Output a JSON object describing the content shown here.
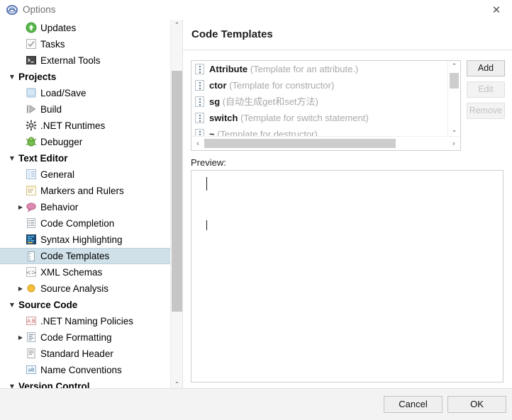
{
  "window": {
    "title": "Options",
    "icon": "app-logo-icon",
    "close_label": "✕"
  },
  "sidebar": {
    "scroll_up": "⌃",
    "scroll_down": "⌄",
    "items": [
      {
        "label": "Updates",
        "level": 1,
        "icon": "updates-icon",
        "expander": "",
        "group": false,
        "selected": false
      },
      {
        "label": "Tasks",
        "level": 1,
        "icon": "tasks-icon",
        "expander": "",
        "group": false,
        "selected": false
      },
      {
        "label": "External Tools",
        "level": 1,
        "icon": "external-tools-icon",
        "expander": "",
        "group": false,
        "selected": false
      },
      {
        "label": "Projects",
        "level": 0,
        "icon": "",
        "expander": "▼",
        "group": true,
        "selected": false
      },
      {
        "label": "Load/Save",
        "level": 1,
        "icon": "load-save-icon",
        "expander": "",
        "group": false,
        "selected": false
      },
      {
        "label": "Build",
        "level": 1,
        "icon": "build-icon",
        "expander": "",
        "group": false,
        "selected": false
      },
      {
        "label": ".NET Runtimes",
        "level": 1,
        "icon": "dotnet-runtimes-icon",
        "expander": "",
        "group": false,
        "selected": false
      },
      {
        "label": "Debugger",
        "level": 1,
        "icon": "debugger-icon",
        "expander": "",
        "group": false,
        "selected": false
      },
      {
        "label": "Text Editor",
        "level": 0,
        "icon": "",
        "expander": "▼",
        "group": true,
        "selected": false
      },
      {
        "label": "General",
        "level": 1,
        "icon": "general-icon",
        "expander": "",
        "group": false,
        "selected": false
      },
      {
        "label": "Markers and Rulers",
        "level": 1,
        "icon": "markers-rulers-icon",
        "expander": "",
        "group": false,
        "selected": false
      },
      {
        "label": "Behavior",
        "level": 1,
        "icon": "behavior-icon",
        "expander": "▶",
        "group": false,
        "selected": false
      },
      {
        "label": "Code Completion",
        "level": 1,
        "icon": "code-completion-icon",
        "expander": "",
        "group": false,
        "selected": false
      },
      {
        "label": "Syntax Highlighting",
        "level": 1,
        "icon": "syntax-highlighting-icon",
        "expander": "",
        "group": false,
        "selected": false
      },
      {
        "label": "Code Templates",
        "level": 1,
        "icon": "code-templates-icon",
        "expander": "",
        "group": false,
        "selected": true
      },
      {
        "label": "XML Schemas",
        "level": 1,
        "icon": "xml-schemas-icon",
        "expander": "",
        "group": false,
        "selected": false
      },
      {
        "label": "Source Analysis",
        "level": 1,
        "icon": "source-analysis-icon",
        "expander": "▶",
        "group": false,
        "selected": false
      },
      {
        "label": "Source Code",
        "level": 0,
        "icon": "",
        "expander": "▼",
        "group": true,
        "selected": false
      },
      {
        "label": ".NET Naming Policies",
        "level": 1,
        "icon": "naming-policies-icon",
        "expander": "",
        "group": false,
        "selected": false
      },
      {
        "label": "Code Formatting",
        "level": 1,
        "icon": "code-formatting-icon",
        "expander": "▶",
        "group": false,
        "selected": false
      },
      {
        "label": "Standard Header",
        "level": 1,
        "icon": "standard-header-icon",
        "expander": "",
        "group": false,
        "selected": false
      },
      {
        "label": "Name Conventions",
        "level": 1,
        "icon": "name-conventions-icon",
        "expander": "",
        "group": false,
        "selected": false
      },
      {
        "label": "Version Control",
        "level": 0,
        "icon": "",
        "expander": "▼",
        "group": true,
        "selected": false
      }
    ]
  },
  "main": {
    "page_title": "Code Templates",
    "templates": [
      {
        "name": "Attribute",
        "description": "(Template for an attribute.)"
      },
      {
        "name": "ctor",
        "description": "(Template for constructor)"
      },
      {
        "name": "sg",
        "description": "(自动生成get和set方法)"
      },
      {
        "name": "switch",
        "description": "(Template for switch statement)"
      },
      {
        "name": "~",
        "description": "(Template for destructor)"
      }
    ],
    "list_scroll": {
      "up": "⌃",
      "down": "⌄",
      "left": "‹",
      "right": "›"
    },
    "buttons": {
      "add": "Add",
      "edit": "Edit",
      "remove": "Remove"
    },
    "preview_label": "Preview:",
    "preview_text": ""
  },
  "footer": {
    "cancel": "Cancel",
    "ok": "OK"
  },
  "colors": {
    "selection": "#cfe0e8",
    "description_text": "#a9a9a9",
    "disabled_text": "#c2c2c2",
    "scrollbar_thumb": "#c6c6c6"
  }
}
